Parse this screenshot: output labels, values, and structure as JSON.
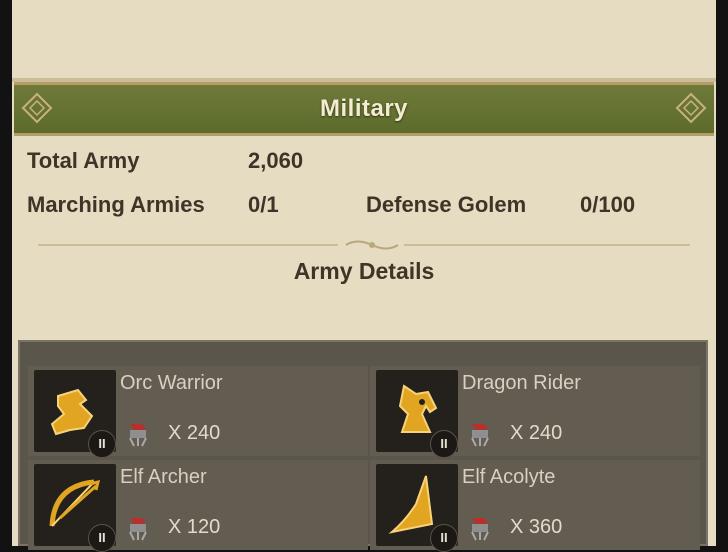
{
  "military": {
    "title": "Military",
    "total_army_label": "Total Army",
    "total_army_value": "2,060",
    "marching_label": "Marching Armies",
    "marching_value": "0/1",
    "golem_label": "Defense Golem",
    "golem_value": "0/100",
    "army_details_title": "Army Details"
  },
  "units": [
    {
      "name": "Orc Warrior",
      "count": "X 240",
      "icon": "boot-icon"
    },
    {
      "name": "Dragon Rider",
      "count": "X 240",
      "icon": "horse-head-icon"
    },
    {
      "name": "Elf Archer",
      "count": "X 120",
      "icon": "bow-icon"
    },
    {
      "name": "Elf Acolyte",
      "count": "X 360",
      "icon": "wizard-hat-icon"
    }
  ],
  "badge_symbol": "II",
  "colors": {
    "banner": "#6f7a3a",
    "panel": "#e6dcc2",
    "army_box": "#5b564c",
    "gold": "#e2a521"
  }
}
